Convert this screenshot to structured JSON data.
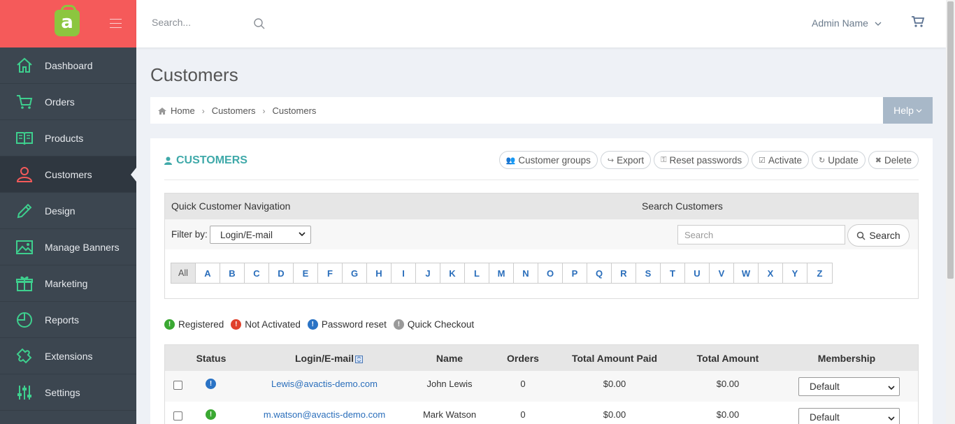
{
  "sidebar": {
    "logo_letter": "a",
    "items": [
      {
        "label": "Dashboard",
        "icon": "home-icon"
      },
      {
        "label": "Orders",
        "icon": "cart-icon"
      },
      {
        "label": "Products",
        "icon": "book-icon"
      },
      {
        "label": "Customers",
        "icon": "user-icon",
        "active": true
      },
      {
        "label": "Design",
        "icon": "pencil-icon"
      },
      {
        "label": "Manage Banners",
        "icon": "image-icon"
      },
      {
        "label": "Marketing",
        "icon": "gift-icon"
      },
      {
        "label": "Reports",
        "icon": "pie-chart-icon"
      },
      {
        "label": "Extensions",
        "icon": "puzzle-icon"
      },
      {
        "label": "Settings",
        "icon": "sliders-icon"
      }
    ]
  },
  "topbar": {
    "search_placeholder": "Search...",
    "admin_name": "Admin Name"
  },
  "page": {
    "title": "Customers",
    "breadcrumb": [
      "Home",
      "Customers",
      "Customers"
    ],
    "help_label": "Help"
  },
  "panel": {
    "title": "CUSTOMERS",
    "actions": [
      "Customer groups",
      "Export",
      "Reset passwords",
      "Activate",
      "Update",
      "Delete"
    ]
  },
  "quick_nav": {
    "title": "Quick Customer Navigation",
    "search_title": "Search Customers",
    "filter_label": "Filter by:",
    "filter_value": "Login/E-mail",
    "search_placeholder": "Search",
    "search_button": "Search",
    "letters": [
      "All",
      "A",
      "B",
      "C",
      "D",
      "E",
      "F",
      "G",
      "H",
      "I",
      "J",
      "K",
      "L",
      "M",
      "N",
      "O",
      "P",
      "Q",
      "R",
      "S",
      "T",
      "U",
      "V",
      "W",
      "X",
      "Y",
      "Z"
    ]
  },
  "legend": [
    {
      "label": "Registered",
      "color": "#3aa832"
    },
    {
      "label": "Not Activated",
      "color": "#e0412c"
    },
    {
      "label": "Password reset",
      "color": "#2a73c5"
    },
    {
      "label": "Quick Checkout",
      "color": "#9a9a9a"
    }
  ],
  "table": {
    "headers": [
      "Status",
      "Login/E-mail",
      "Name",
      "Orders",
      "Total Amount Paid",
      "Total Amount",
      "Membership"
    ],
    "rows": [
      {
        "status_color": "#2a73c5",
        "email": "Lewis@avactis-demo.com",
        "name": "John Lewis",
        "orders": "0",
        "paid": "$0.00",
        "total": "$0.00",
        "membership": "Default"
      },
      {
        "status_color": "#3aa832",
        "email": "m.watson@avactis-demo.com",
        "name": "Mark Watson",
        "orders": "0",
        "paid": "$0.00",
        "total": "$0.00",
        "membership": "Default"
      }
    ]
  },
  "colors": {
    "sidebar_bg": "#3c4650",
    "logo_bg": "#f55a5a",
    "accent": "#3fa9a9",
    "link": "#2a6ebb",
    "icon_green": "#3ecf8e"
  }
}
